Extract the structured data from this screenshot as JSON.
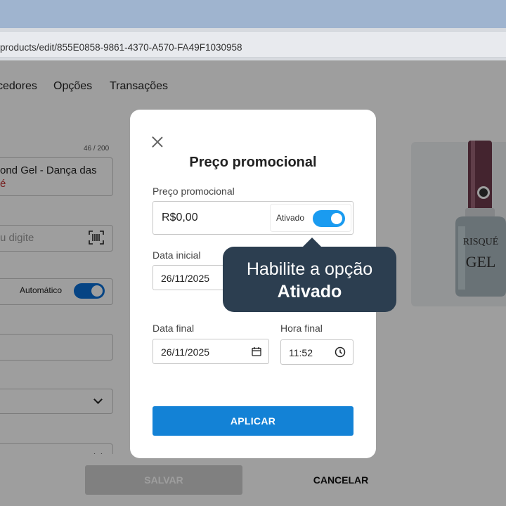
{
  "browser": {
    "url": "products/edit/855E0858-9861-4370-A570-FA49F1030958"
  },
  "page": {
    "nav_tabs": [
      "cedores",
      "Opções",
      "Transações"
    ],
    "name_counter": "46 / 200",
    "name_line1": "ond Gel - Dança das",
    "name_line2": "é",
    "barcode_placeholder": "u digite",
    "auto_label": "Automático",
    "footer": {
      "save_label": "SALVAR",
      "cancel_label": "CANCELAR"
    }
  },
  "modal": {
    "title": "Preço promocional",
    "price_label": "Preço promocional",
    "price_value": "R$0,00",
    "toggle_label": "Ativado",
    "toggle_on": true,
    "start_date_label": "Data inicial",
    "start_date_value": "26/11/2025",
    "end_date_label": "Data final",
    "end_date_value": "26/11/2025",
    "end_time_label": "Hora final",
    "end_time_value": "11:52",
    "apply_label": "APLICAR"
  },
  "tooltip": {
    "line1": "Habilite a opção",
    "line2": "Ativado"
  },
  "colors": {
    "accent": "#1382d6",
    "toggle_on": "#1a9bf0",
    "tooltip_bg": "#2c3e50"
  }
}
